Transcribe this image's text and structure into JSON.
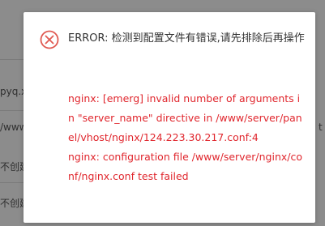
{
  "background": {
    "fragments": [
      "pyq.x",
      "/www",
      "不创建",
      "不创建"
    ],
    "right_fragment": "t"
  },
  "dialog": {
    "icon": "error-circle-x-icon",
    "title": "ERROR: 检测到配置文件有错误,请先排除后再操作",
    "detail_lines": [
      "nginx: [emerg] invalid number of arguments in \"server_name\" directive in /www/server/panel/vhost/nginx/124.223.30.217.conf:4",
      "nginx: configuration file /www/server/nginx/conf/nginx.conf test failed"
    ]
  },
  "colors": {
    "error_red": "#e0262d",
    "icon_red": "#e05a52",
    "title_text": "#333333"
  }
}
